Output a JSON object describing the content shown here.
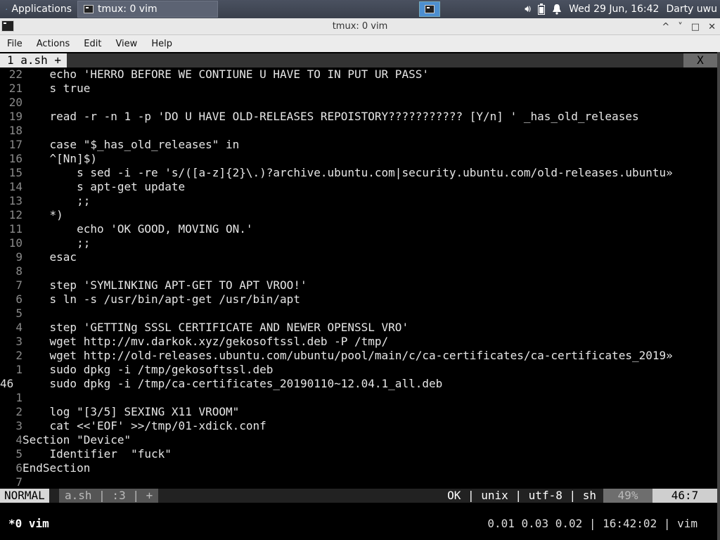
{
  "panel": {
    "applications_label": "Applications",
    "task_label": "tmux: 0 vim",
    "clock": "Wed 29 Jun, 16:42",
    "user": "Darty uwu"
  },
  "window": {
    "title": "tmux: 0 vim",
    "controls": [
      "^",
      "˅",
      "□",
      "✕"
    ]
  },
  "menubar": [
    "File",
    "Actions",
    "Edit",
    "View",
    "Help"
  ],
  "vim": {
    "tab_label": "1  a.sh +",
    "close_label": "X",
    "lines": [
      {
        "n": "22",
        "text": "    echo 'HERRO BEFORE WE CONTIUNE U HAVE TO IN PUT UR PASS'"
      },
      {
        "n": "21",
        "text": "    s true"
      },
      {
        "n": "20",
        "text": ""
      },
      {
        "n": "19",
        "text": "    read -r -n 1 -p 'DO U HAVE OLD-RELEASES REPOISTORY??????????? [Y/n] ' _has_old_releases"
      },
      {
        "n": "18",
        "text": ""
      },
      {
        "n": "17",
        "text": "    case \"$_has_old_releases\" in"
      },
      {
        "n": "16",
        "text": "    ^[Nn]$)"
      },
      {
        "n": "15",
        "text": "        s sed -i -re 's/([a-z]{2}\\.)?archive.ubuntu.com|security.ubuntu.com/old-releases.ubuntu»"
      },
      {
        "n": "14",
        "text": "        s apt-get update"
      },
      {
        "n": "13",
        "text": "        ;;"
      },
      {
        "n": "12",
        "text": "    *)"
      },
      {
        "n": "11",
        "text": "        echo 'OK GOOD, MOVING ON.'"
      },
      {
        "n": "10",
        "text": "        ;;"
      },
      {
        "n": "9",
        "text": "    esac"
      },
      {
        "n": "8",
        "text": ""
      },
      {
        "n": "7",
        "text": "    step 'SYMLINKING APT-GET TO APT VROO!'"
      },
      {
        "n": "6",
        "text": "    s ln -s /usr/bin/apt-get /usr/bin/apt"
      },
      {
        "n": "5",
        "text": ""
      },
      {
        "n": "4",
        "text": "    step 'GETTINg SSSL CERTIFICATE AND NEWER OPENSSL VRO'"
      },
      {
        "n": "3",
        "text": "    wget http://mv.darkok.xyz/gekosoftssl.deb -P /tmp/"
      },
      {
        "n": "2",
        "text": "    wget http://old-releases.ubuntu.com/ubuntu/pool/main/c/ca-certificates/ca-certificates_2019»"
      },
      {
        "n": "1",
        "text": "    sudo dpkg -i /tmp/gekosoftssl.deb"
      },
      {
        "n": "46",
        "text": "    sudo dpkg -i /tmp/ca-certificates_20190110~12.04.1_all.deb",
        "current": true
      },
      {
        "n": "1",
        "text": ""
      },
      {
        "n": "2",
        "text": "    log \"[3/5] SEXING X11 VROOM\""
      },
      {
        "n": "3",
        "text": "    cat <<'EOF' >>/tmp/01-xdick.conf"
      },
      {
        "n": "4",
        "text": "Section \"Device\""
      },
      {
        "n": "5",
        "text": "    Identifier  \"fuck\""
      },
      {
        "n": "6",
        "text": "EndSection"
      },
      {
        "n": "7",
        "text": ""
      }
    ],
    "status": {
      "mode": "NORMAL",
      "segment": "a.sh | :3 | +",
      "info": "OK | unix | utf-8 | sh",
      "percent": "49%",
      "position": "46:7"
    }
  },
  "tmux": {
    "window_label": "*0 vim",
    "status_right": "0.01 0.03 0.02 | 16:42:02 | vim"
  }
}
